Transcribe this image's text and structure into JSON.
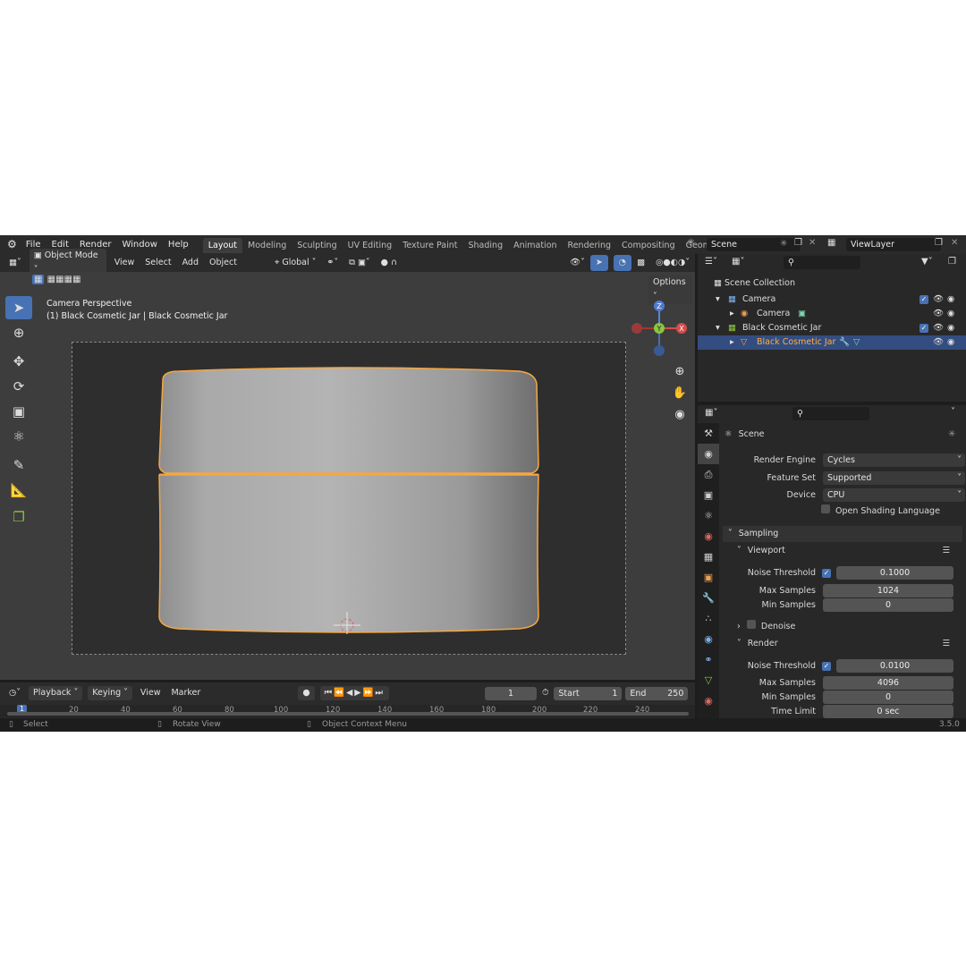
{
  "app": {
    "menu": [
      "File",
      "Edit",
      "Render",
      "Window",
      "Help"
    ],
    "workspaces": [
      "Layout",
      "Modeling",
      "Sculpting",
      "UV Editing",
      "Texture Paint",
      "Shading",
      "Animation",
      "Rendering",
      "Compositing",
      "Geometry Noc"
    ],
    "active_workspace": "Layout",
    "scene_name": "Scene",
    "view_layer": "ViewLayer",
    "version": "3.5.0"
  },
  "viewport_header": {
    "mode": "Object Mode",
    "menus": [
      "View",
      "Select",
      "Add",
      "Object"
    ],
    "orientation": "Global",
    "options_label": "Options"
  },
  "viewport": {
    "overlay_line1": "Camera Perspective",
    "overlay_line2": "(1) Black Cosmetic Jar | Black Cosmetic Jar",
    "gizmo": {
      "z": "Z",
      "y": "Y",
      "x": "X"
    },
    "colors": {
      "background": "#3d3d3d",
      "selection": "#f5a742",
      "jar": "#b8b8b8"
    }
  },
  "tools": [
    "select-box-icon",
    "cursor-icon",
    "move-icon",
    "rotate-icon",
    "scale-icon",
    "transform-icon",
    "annotate-icon",
    "measure-icon",
    "add-cube-icon"
  ],
  "outliner": {
    "root": "Scene Collection",
    "items": [
      {
        "label": "Camera",
        "level": 1,
        "kind": "collection"
      },
      {
        "label": "Camera",
        "level": 2,
        "kind": "object"
      },
      {
        "label": "Black Cosmetic Jar",
        "level": 1,
        "kind": "collection"
      },
      {
        "label": "Black Cosmetic Jar",
        "level": 2,
        "kind": "object",
        "selected": true
      }
    ]
  },
  "properties": {
    "context": "Scene",
    "render_engine_label": "Render Engine",
    "render_engine": "Cycles",
    "feature_set_label": "Feature Set",
    "feature_set": "Supported",
    "device_label": "Device",
    "device": "CPU",
    "osl_label": "Open Shading Language",
    "sampling": "Sampling",
    "viewport_section": "Viewport",
    "vp_noise_label": "Noise Threshold",
    "vp_noise": "0.1000",
    "vp_max_label": "Max Samples",
    "vp_max": "1024",
    "vp_min_label": "Min Samples",
    "vp_min": "0",
    "denoise": "Denoise",
    "render_section": "Render",
    "r_noise_label": "Noise Threshold",
    "r_noise": "0.0100",
    "r_max_label": "Max Samples",
    "r_max": "4096",
    "r_min_label": "Min Samples",
    "r_min": "0",
    "time_limit_label": "Time Limit",
    "time_limit": "0 sec"
  },
  "timeline": {
    "menus": [
      "Playback",
      "Keying",
      "View",
      "Marker"
    ],
    "current_frame": "1",
    "start_label": "Start",
    "start": "1",
    "end_label": "End",
    "end": "250",
    "ticks": [
      "1",
      "20",
      "40",
      "60",
      "80",
      "100",
      "120",
      "140",
      "160",
      "180",
      "200",
      "220",
      "240"
    ]
  },
  "status": {
    "select": "Select",
    "rotate": "Rotate View",
    "context": "Object Context Menu"
  }
}
